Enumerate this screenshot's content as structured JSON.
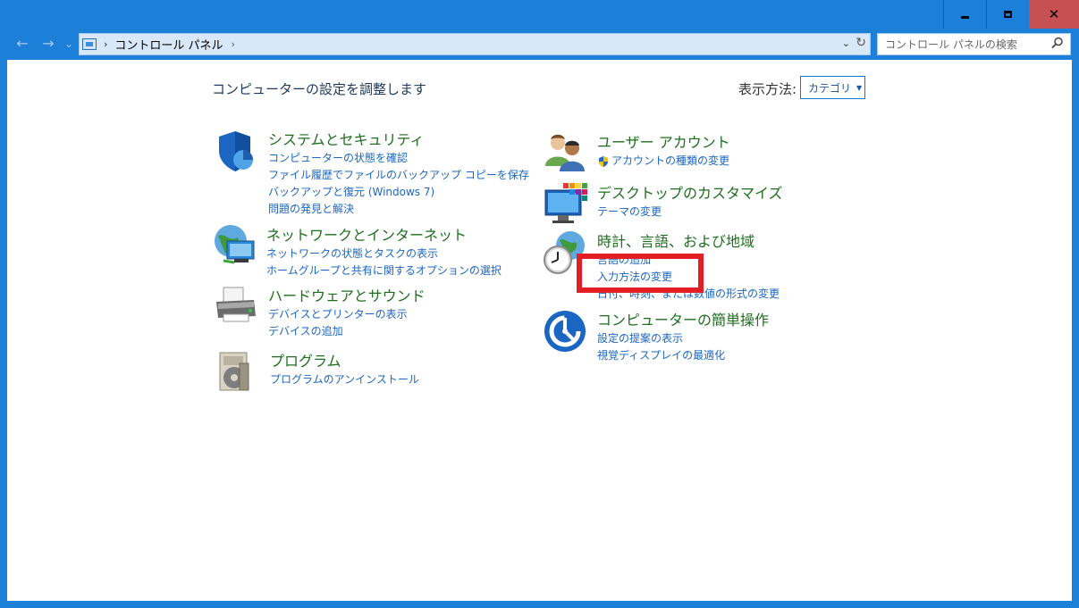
{
  "window": {
    "controls": {
      "minimize": "minimize",
      "maximize": "maximize",
      "close": "close"
    }
  },
  "nav": {
    "back": "←",
    "forward": "→",
    "recent": "⌄",
    "breadcrumb": [
      "コントロール パネル"
    ],
    "search_placeholder": "コントロール パネルの検索"
  },
  "page": {
    "heading": "コンピューターの設定を調整します",
    "view_by_label": "表示方法:",
    "view_by_value": "カテゴリ"
  },
  "categories": [
    {
      "id": "system-security",
      "title": "システムとセキュリティ",
      "icon": "shield-icon",
      "links": [
        "コンピューターの状態を確認",
        "ファイル履歴でファイルのバックアップ コピーを保存",
        "バックアップと復元 (Windows 7)",
        "問題の発見と解決"
      ]
    },
    {
      "id": "network-internet",
      "title": "ネットワークとインターネット",
      "icon": "network-globe-icon",
      "links": [
        "ネットワークの状態とタスクの表示",
        "ホームグループと共有に関するオプションの選択"
      ]
    },
    {
      "id": "hardware-sound",
      "title": "ハードウェアとサウンド",
      "icon": "printer-icon",
      "links": [
        "デバイスとプリンターの表示",
        "デバイスの追加"
      ]
    },
    {
      "id": "programs",
      "title": "プログラム",
      "icon": "programs-disc-icon",
      "links": [
        "プログラムのアンインストール"
      ]
    },
    {
      "id": "user-accounts",
      "title": "ユーザー アカウント",
      "icon": "users-icon",
      "links": [
        "アカウントの種類の変更"
      ]
    },
    {
      "id": "appearance",
      "title": "デスクトップのカスタマイズ",
      "icon": "monitor-palette-icon",
      "links": [
        "テーマの変更"
      ]
    },
    {
      "id": "clock-region",
      "title": "時計、言語、および地域",
      "icon": "clock-globe-icon",
      "links": [
        "言語の追加",
        "入力方法の変更",
        "日付、時刻、または数値の形式の変更"
      ]
    },
    {
      "id": "ease-of-access",
      "title": "コンピューターの簡単操作",
      "icon": "ease-of-access-icon",
      "links": [
        "設定の提案の表示",
        "視覚ディスプレイの最適化"
      ]
    }
  ],
  "colors": {
    "frame": "#1c7fd8",
    "category_title": "#1e6e1e",
    "link": "#1a66c2",
    "highlight": "#e31e24"
  }
}
